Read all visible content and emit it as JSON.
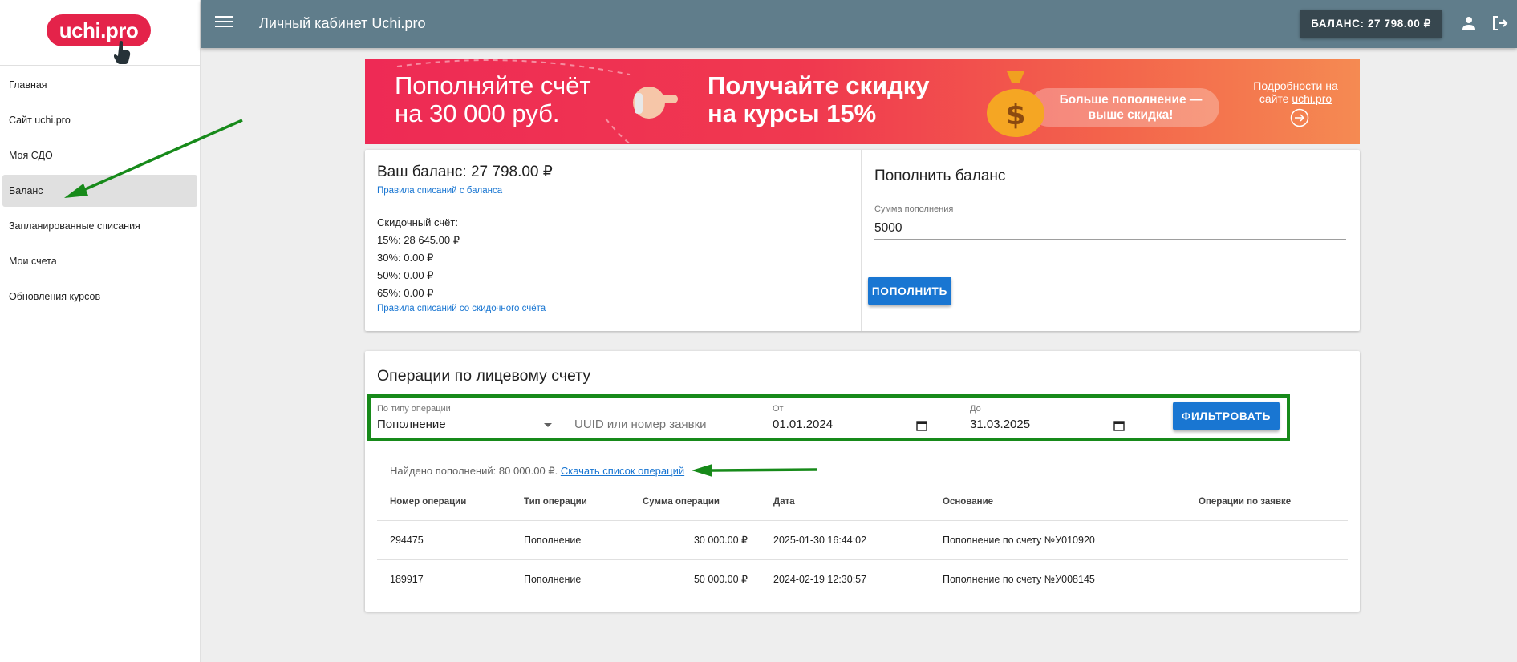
{
  "logo": {
    "text": "uchi.pro"
  },
  "sidebar": {
    "items": [
      {
        "label": "Главная"
      },
      {
        "label": "Сайт uchi.pro"
      },
      {
        "label": "Моя СДО"
      },
      {
        "label": "Баланс",
        "active": true
      },
      {
        "label": "Запланированные списания"
      },
      {
        "label": "Мои счета"
      },
      {
        "label": "Обновления курсов"
      }
    ]
  },
  "header": {
    "title": "Личный кабинет Uchi.pro",
    "balance": "БАЛАНС: 27 798.00 ₽",
    "icons": [
      "menu-icon",
      "user-icon",
      "logout-icon"
    ]
  },
  "banner": {
    "left_line1": "Пополняйте счёт",
    "left_line2": "на 30 000 руб.",
    "mid_line1": "Получайте скидку",
    "mid_line2": "на курсы 15%",
    "pill_line1": "Больше пополнение —",
    "pill_line2": "выше скидка!",
    "details_line1": "Подробности на",
    "details_line2": "сайте",
    "details_link": "uchi.pro"
  },
  "balance": {
    "title": "Ваш баланс: 27 798.00 ₽",
    "rules_link": "Правила списаний с баланса",
    "discount_title": "Скидочный счёт:",
    "discounts": [
      "15%: 28 645.00 ₽",
      "30%: 0.00 ₽",
      "50%: 0.00 ₽",
      "65%: 0.00 ₽"
    ],
    "discount_rules_link": "Правила списаний со скидочного счёта"
  },
  "topup": {
    "title": "Пополнить баланс",
    "amount_label": "Сумма пополнения",
    "amount_value": "5000",
    "button": "ПОПОЛНИТЬ"
  },
  "operations": {
    "title": "Операции по лицевому счету",
    "filter": {
      "type_label": "По типу операции",
      "type_value": "Пополнение",
      "uuid_placeholder": "UUID или номер заявки",
      "from_label": "От",
      "from_value": "01.01.2024",
      "to_label": "До",
      "to_value": "31.03.2025",
      "button": "ФИЛЬТРОВАТЬ"
    },
    "found_text": "Найдено пополнений: 80 000.00 ₽.",
    "download_link": "Скачать список операций",
    "columns": [
      "Номер операции",
      "Тип операции",
      "Сумма операции",
      "Дата",
      "Основание",
      "Операции по заявке"
    ],
    "rows": [
      [
        "294475",
        "Пополнение",
        "30 000.00 ₽",
        "2025-01-30 16:44:02",
        "Пополнение по счету №У010920",
        ""
      ],
      [
        "189917",
        "Пополнение",
        "50 000.00 ₽",
        "2024-02-19 12:30:57",
        "Пополнение по счету №У008145",
        ""
      ]
    ]
  },
  "colors": {
    "topbar": "#607d8b",
    "primary": "#1976d2",
    "annotation": "#178a1a",
    "logo": "#e4234a"
  }
}
